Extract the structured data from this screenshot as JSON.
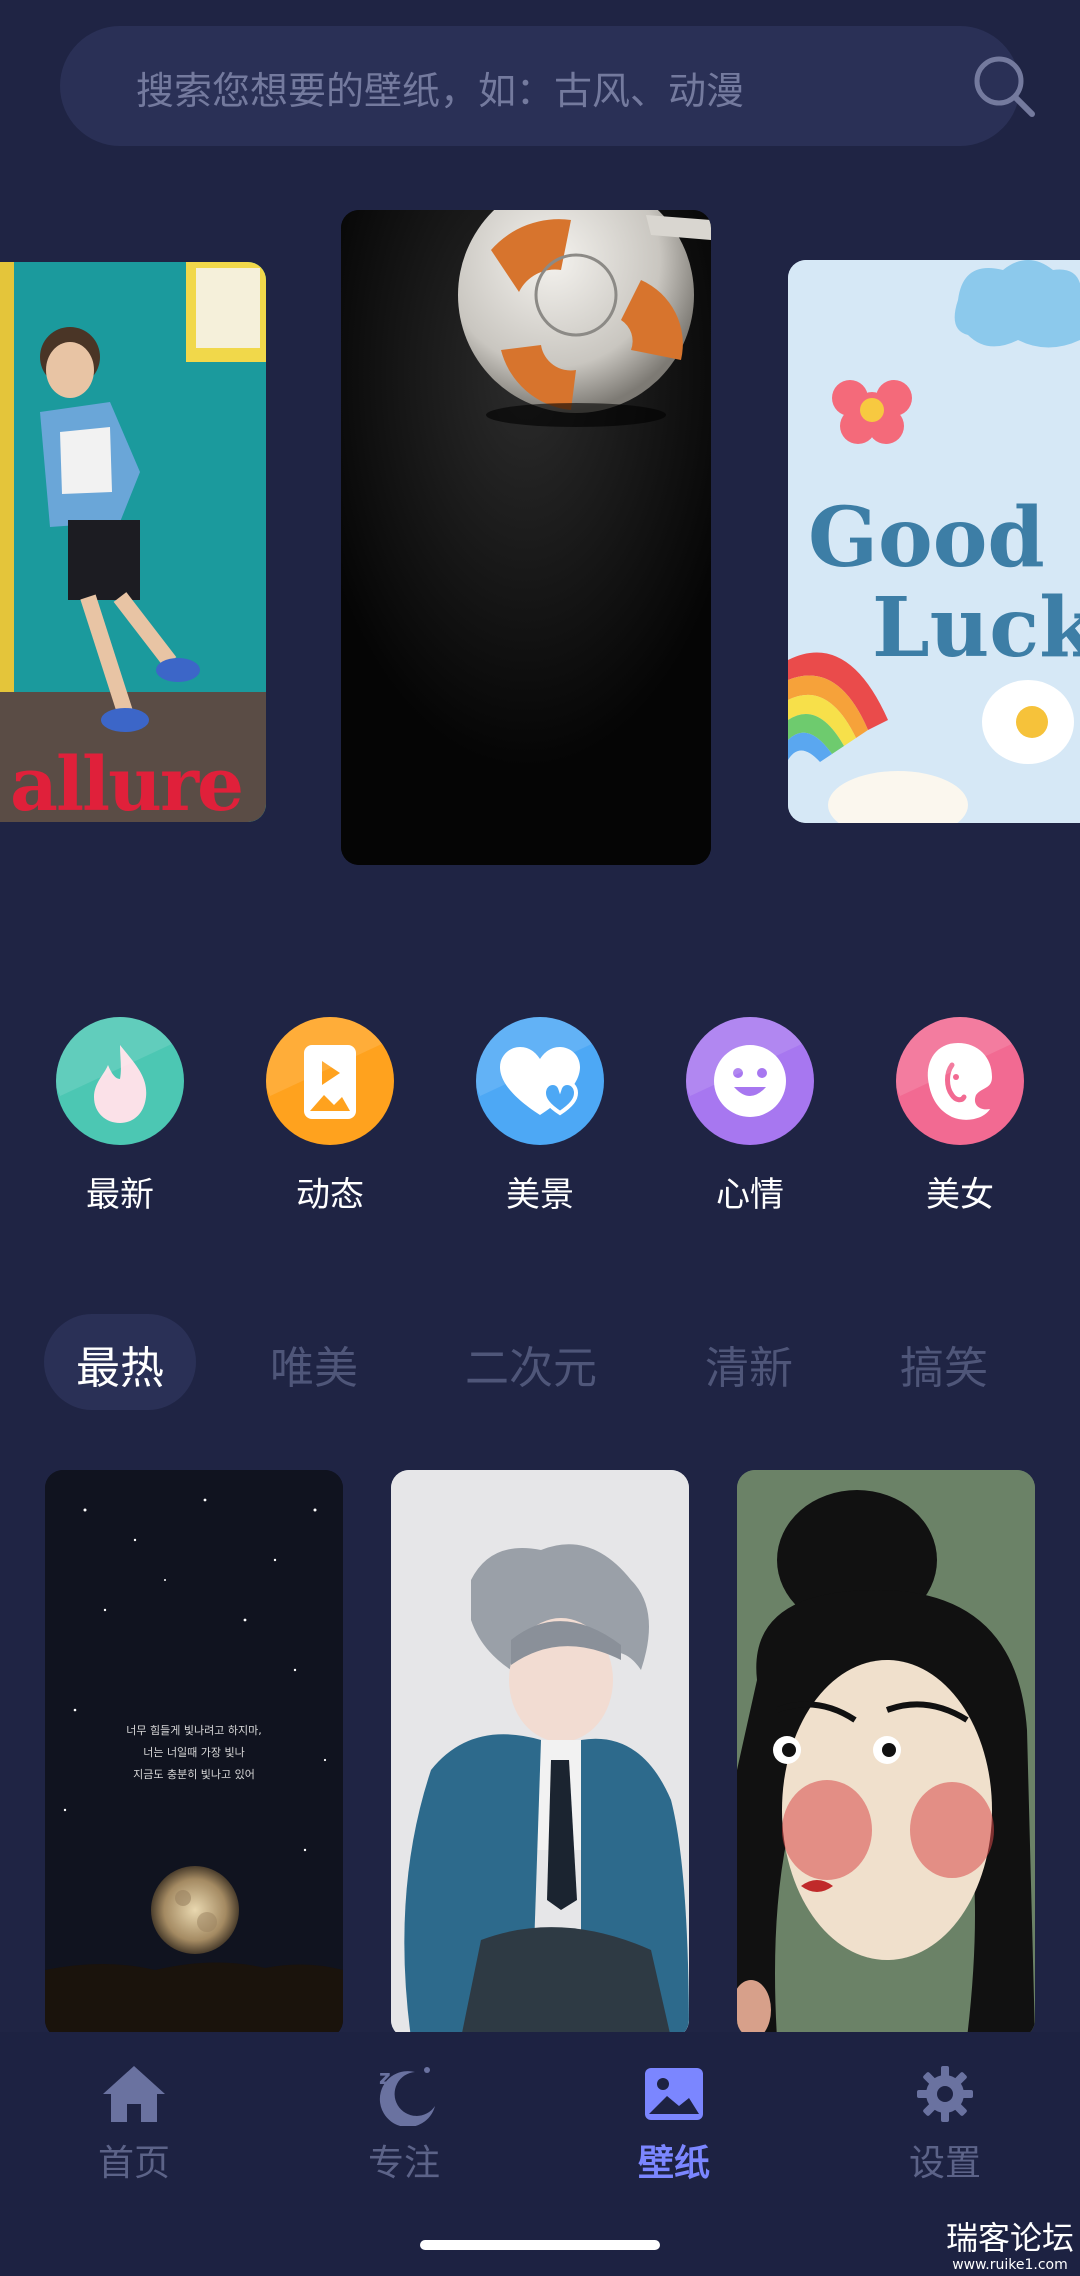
{
  "search": {
    "placeholder": "搜索您想要的壁纸，如：古风、动漫",
    "icon": "search-icon"
  },
  "banner": {
    "left_card_text": "allure",
    "right_card_text_line1": "Good",
    "right_card_text_line2": "Luck"
  },
  "categories": [
    {
      "label": "最新",
      "icon": "flame-icon",
      "color": "#4cc7b3"
    },
    {
      "label": "动态",
      "icon": "phone-play-icon",
      "color": "#ffa21e"
    },
    {
      "label": "美景",
      "icon": "heart-icon",
      "color": "#4da8f5"
    },
    {
      "label": "心情",
      "icon": "smile-icon",
      "color": "#a777f0"
    },
    {
      "label": "美女",
      "icon": "woman-face-icon",
      "color": "#f26a92"
    }
  ],
  "tabs": [
    {
      "label": "最热",
      "active": true
    },
    {
      "label": "唯美",
      "active": false
    },
    {
      "label": "二次元",
      "active": false
    },
    {
      "label": "清新",
      "active": false
    },
    {
      "label": "搞笑",
      "active": false
    }
  ],
  "grid": {
    "moon_text_line1": "너무 힘들게 빛나려고 하지마,",
    "moon_text_line2": "너는 너일때 가장 빛나",
    "moon_text_line3": "지금도 충분히 빛나고 있어"
  },
  "nav": [
    {
      "label": "首页",
      "icon": "home-icon",
      "active": false
    },
    {
      "label": "专注",
      "icon": "moon-icon",
      "active": false
    },
    {
      "label": "壁纸",
      "icon": "image-icon",
      "active": true
    },
    {
      "label": "设置",
      "icon": "gear-icon",
      "active": false
    }
  ],
  "watermark": {
    "title": "瑞客论坛",
    "url": "www.ruike1.com"
  },
  "colors": {
    "background": "#1f2444",
    "accent": "#7b86ff",
    "inactive": "#5c6388"
  }
}
